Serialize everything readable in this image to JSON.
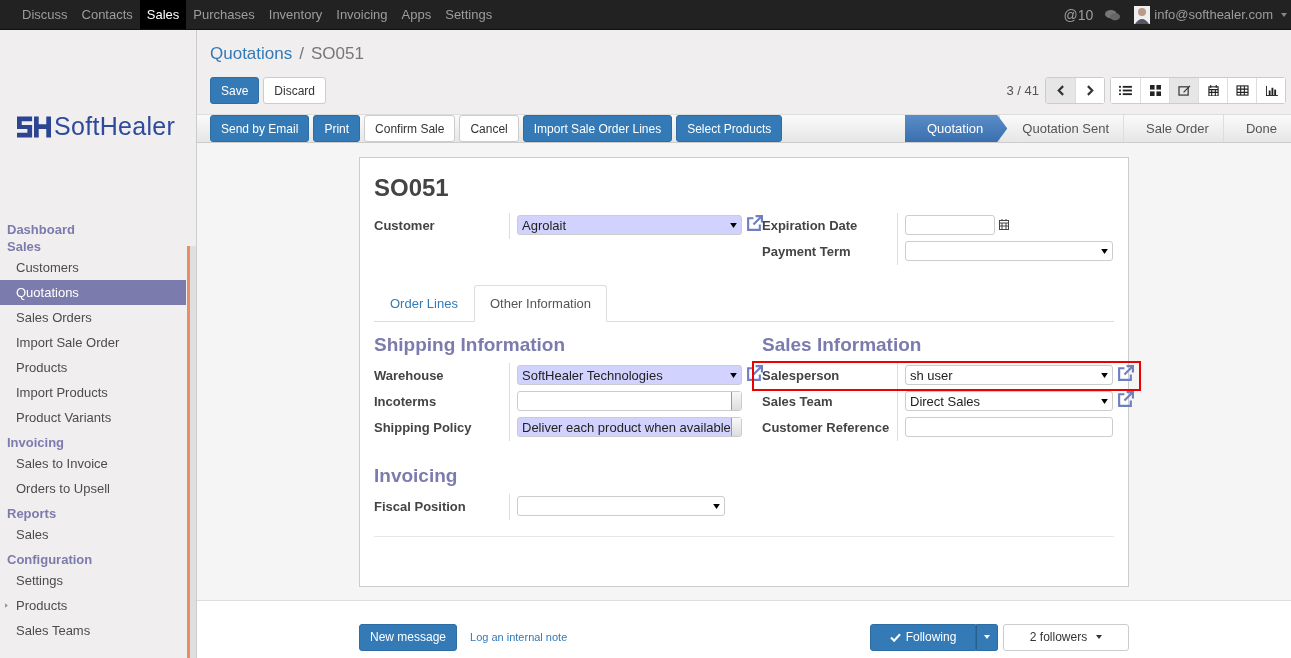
{
  "top_menu": [
    {
      "label": "Discuss",
      "selected": false
    },
    {
      "label": "Contacts",
      "selected": false
    },
    {
      "label": "Sales",
      "selected": true
    },
    {
      "label": "Purchases",
      "selected": false
    },
    {
      "label": "Inventory",
      "selected": false
    },
    {
      "label": "Invoicing",
      "selected": false
    },
    {
      "label": "Apps",
      "selected": false
    },
    {
      "label": "Settings",
      "selected": false
    }
  ],
  "systray": {
    "mention_symbol": "@",
    "mention_count": "10",
    "user": "info@softhealer.com"
  },
  "logo": {
    "text": "SoftHealer"
  },
  "sidebar": [
    {
      "title": "Dashboard"
    },
    {
      "title": "Sales",
      "items": [
        {
          "label": "Customers",
          "selected": false,
          "kind": "link"
        },
        {
          "label": "Quotations",
          "selected": true,
          "kind": "link"
        },
        {
          "label": "Sales Orders",
          "selected": false,
          "kind": "link"
        },
        {
          "label": "Import Sale Order",
          "selected": false,
          "kind": "link"
        },
        {
          "label": "Products",
          "selected": false,
          "kind": "link"
        },
        {
          "label": "Import Products",
          "selected": false,
          "kind": "link"
        },
        {
          "label": "Product Variants",
          "selected": false,
          "kind": "link"
        }
      ]
    },
    {
      "title": "Invoicing",
      "items": [
        {
          "label": "Sales to Invoice",
          "selected": false,
          "kind": "link"
        },
        {
          "label": "Orders to Upsell",
          "selected": false,
          "kind": "link"
        }
      ]
    },
    {
      "title": "Reports",
      "items": [
        {
          "label": "Sales",
          "selected": false,
          "kind": "link"
        }
      ]
    },
    {
      "title": "Configuration",
      "items": [
        {
          "label": "Settings",
          "selected": false,
          "kind": "link"
        },
        {
          "label": "Products",
          "selected": false,
          "kind": "folder"
        },
        {
          "label": "Sales Teams",
          "selected": false,
          "kind": "link"
        }
      ]
    }
  ],
  "breadcrumb": [
    "Quotations",
    "SO051"
  ],
  "breadcrumb_separator": "/",
  "edit_buttons": [
    {
      "label": "Save",
      "kind": "primary"
    },
    {
      "label": "Discard",
      "kind": "default"
    }
  ],
  "pager": "3 / 41",
  "views": [
    {
      "kind": "list",
      "selected": false
    },
    {
      "kind": "kanban",
      "selected": false
    },
    {
      "kind": "form",
      "selected": true
    },
    {
      "kind": "calendar",
      "selected": false
    },
    {
      "kind": "pivot",
      "selected": false
    },
    {
      "kind": "graph",
      "selected": false
    }
  ],
  "actions": [
    {
      "label": "Send by Email",
      "kind": "primary"
    },
    {
      "label": "Print",
      "kind": "primary"
    },
    {
      "label": "Confirm Sale",
      "kind": "default"
    },
    {
      "label": "Cancel",
      "kind": "default"
    },
    {
      "label": "Import Sale Order Lines",
      "kind": "primary"
    },
    {
      "label": "Select Products",
      "kind": "primary"
    }
  ],
  "stages": [
    {
      "label": "Quotation",
      "selected": true
    },
    {
      "label": "Quotation Sent",
      "selected": false
    },
    {
      "label": "Sale Order",
      "selected": false
    },
    {
      "label": "Done",
      "selected": false
    }
  ],
  "form": {
    "title": "SO051",
    "fields_left": [
      {
        "label": "Customer",
        "kind": "many2one",
        "value": "Agrolait",
        "required": true,
        "highlighted": false
      }
    ],
    "fields_right": [
      {
        "label": "Expiration Date",
        "kind": "date",
        "required": false,
        "highlighted": false
      },
      {
        "label": "Payment Term",
        "kind": "select",
        "required": false,
        "highlighted": false
      }
    ],
    "tabs": [
      {
        "label": "Order Lines",
        "selected": false
      },
      {
        "label": "Other Information",
        "selected": true
      }
    ],
    "sections": [
      {
        "title": "Shipping Information",
        "fields": [
          {
            "label": "Warehouse",
            "kind": "many2one",
            "value": "SoftHealer Technologies",
            "required": true,
            "highlighted": false
          },
          {
            "label": "Incoterms",
            "kind": "selection",
            "required": false,
            "highlighted": false
          },
          {
            "label": "Shipping Policy",
            "kind": "selection",
            "value": "Deliver each product when available",
            "required": true,
            "highlighted": false
          }
        ]
      },
      {
        "title": "Sales Information",
        "fields": [
          {
            "label": "Salesperson",
            "kind": "many2one",
            "value": "sh user",
            "required": false,
            "highlighted": true
          },
          {
            "label": "Sales Team",
            "kind": "many2one",
            "value": "Direct Sales",
            "required": false,
            "highlighted": false
          },
          {
            "label": "Customer Reference",
            "kind": "text",
            "required": false,
            "highlighted": false
          }
        ]
      },
      {
        "title": "Invoicing",
        "fields": [
          {
            "label": "Fiscal Position",
            "kind": "select",
            "required": false,
            "highlighted": false
          }
        ]
      }
    ]
  },
  "chatter": {
    "new_message": "New message",
    "log_note": "Log an internal note",
    "following": "Following",
    "followers": "2 followers"
  }
}
